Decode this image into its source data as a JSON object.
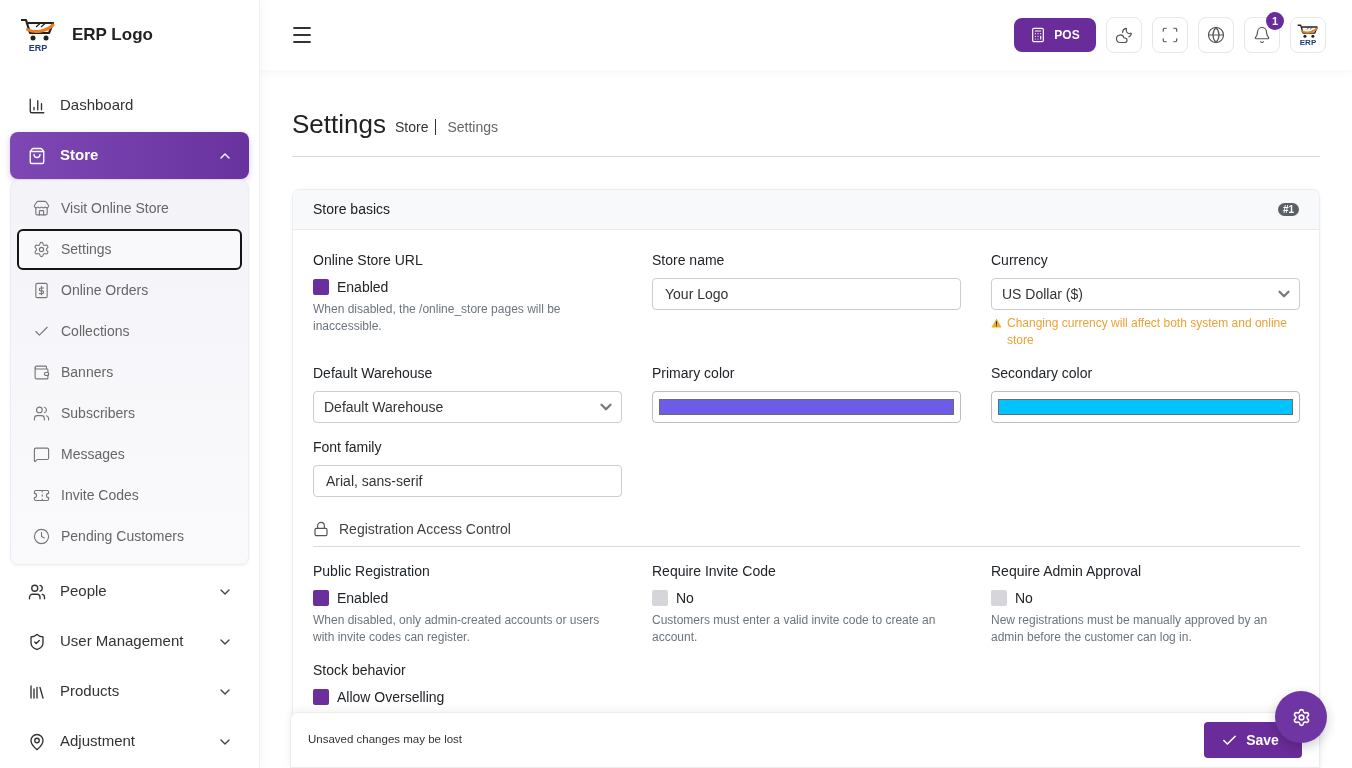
{
  "sidebar": {
    "brand": {
      "mark": "ERP",
      "name": "ERP Logo"
    },
    "items": [
      {
        "label": "Dashboard",
        "kind": "link",
        "selected": false
      },
      {
        "label": "Store",
        "kind": "group",
        "selected": true,
        "expanded": true,
        "children": [
          {
            "label": "Visit Online Store",
            "selected": false
          },
          {
            "label": "Settings",
            "selected": true
          },
          {
            "label": "Online Orders",
            "selected": false
          },
          {
            "label": "Collections",
            "selected": false
          },
          {
            "label": "Banners",
            "selected": false
          },
          {
            "label": "Subscribers",
            "selected": false
          },
          {
            "label": "Messages",
            "selected": false
          },
          {
            "label": "Invite Codes",
            "selected": false
          },
          {
            "label": "Pending Customers",
            "selected": false
          }
        ]
      },
      {
        "label": "People",
        "kind": "group",
        "selected": false,
        "expanded": false
      },
      {
        "label": "User Management",
        "kind": "group",
        "selected": false,
        "expanded": false
      },
      {
        "label": "Products",
        "kind": "group",
        "selected": false,
        "expanded": false
      },
      {
        "label": "Adjustment",
        "kind": "group",
        "selected": false,
        "expanded": false
      }
    ]
  },
  "header": {
    "pos_button": "POS",
    "notification_count": "1",
    "avatar_mark": "ERP"
  },
  "page": {
    "title": "Settings",
    "breadcrumb": [
      "Store",
      "Settings"
    ]
  },
  "card": {
    "title": "Store basics",
    "badge": "#1",
    "fields": [
      {
        "kind": "checkbox",
        "label": "Online Store URL",
        "option": "Enabled",
        "checked": true,
        "help": "When disabled, the /online_store pages will be inaccessible."
      },
      {
        "kind": "text",
        "label": "Store name",
        "value": "Your Logo"
      },
      {
        "kind": "select",
        "label": "Currency",
        "value": "US Dollar ($)",
        "warning": "Changing currency will affect both system and online store"
      },
      {
        "kind": "select",
        "label": "Default Warehouse",
        "value": "Default Warehouse"
      },
      {
        "kind": "color",
        "label": "Primary color",
        "color": "#6c5ce7"
      },
      {
        "kind": "color",
        "label": "Secondary color",
        "color": "#00c3ff"
      },
      {
        "kind": "text",
        "label": "Font family",
        "value": "Arial, sans-serif"
      },
      {
        "kind": "section",
        "label": "Registration Access Control"
      },
      {
        "kind": "checkbox",
        "label": "Public Registration",
        "option": "Enabled",
        "checked": true,
        "help": "When disabled, only admin-created accounts or users with invite codes can register."
      },
      {
        "kind": "checkbox",
        "label": "Require Invite Code",
        "option": "No",
        "checked": false,
        "help": "Customers must enter a valid invite code to create an account."
      },
      {
        "kind": "checkbox",
        "label": "Require Admin Approval",
        "option": "No",
        "checked": false,
        "help": "New registrations must be manually approved by an admin before the customer can log in."
      },
      {
        "kind": "checkbox",
        "label": "Stock behavior",
        "option": "Allow Overselling",
        "checked": true
      }
    ]
  },
  "footer": {
    "note": "Unsaved changes may be lost",
    "save_button": "Save"
  }
}
